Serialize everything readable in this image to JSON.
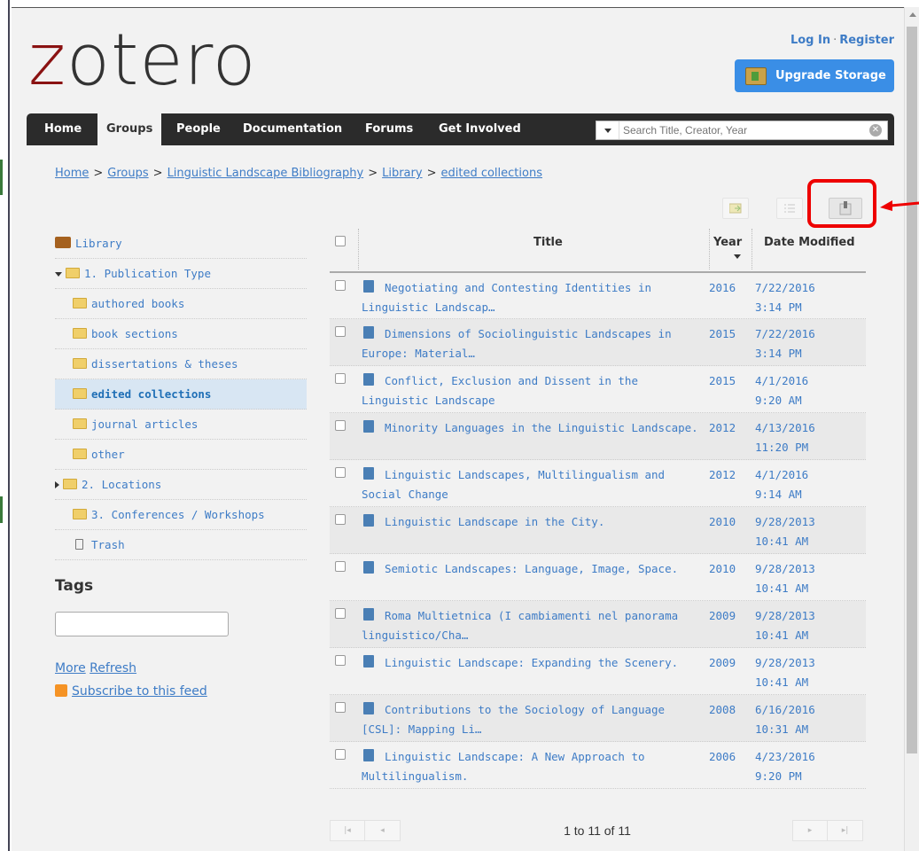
{
  "header": {
    "logo": "zotero",
    "login": "Log In",
    "separator": "·",
    "register": "Register",
    "upgrade": "Upgrade Storage"
  },
  "nav": {
    "items": [
      "Home",
      "Groups",
      "People",
      "Documentation",
      "Forums",
      "Get Involved"
    ],
    "active": "Groups"
  },
  "search": {
    "placeholder": "Search Title, Creator, Year"
  },
  "breadcrumb": [
    "Home",
    "Groups",
    "Linguistic Landscape Bibliography",
    "Library",
    "edited collections"
  ],
  "collections": [
    {
      "label": "Library",
      "icon": "library-icon"
    },
    {
      "label": "1. Publication Type",
      "icon": "folder-icon",
      "expanded": true
    },
    {
      "label": "authored books",
      "icon": "folder-icon"
    },
    {
      "label": "book sections",
      "icon": "folder-icon"
    },
    {
      "label": "dissertations & theses",
      "icon": "folder-icon"
    },
    {
      "label": "edited collections",
      "icon": "folder-icon",
      "selected": true
    },
    {
      "label": "journal articles",
      "icon": "folder-icon"
    },
    {
      "label": "other",
      "icon": "folder-icon"
    },
    {
      "label": "2. Locations",
      "icon": "folder-icon",
      "expanded": false
    },
    {
      "label": "3. Conferences / Workshops",
      "icon": "folder-icon"
    },
    {
      "label": "Trash",
      "icon": "trash-icon"
    }
  ],
  "tags": {
    "heading": "Tags",
    "more": "More",
    "refresh": "Refresh",
    "subscribe": "Subscribe to this feed"
  },
  "table": {
    "headers": {
      "title": "Title",
      "year": "Year",
      "modified": "Date Modified"
    },
    "items": [
      {
        "title": "Negotiating and Contesting Identities in Linguistic Landscap…",
        "year": "2016",
        "date": "7/22/2016",
        "time": "3:14 PM"
      },
      {
        "title": "Dimensions of Sociolinguistic Landscapes in Europe: Material…",
        "year": "2015",
        "date": "7/22/2016",
        "time": "3:14 PM"
      },
      {
        "title": "Conflict, Exclusion and Dissent in the Linguistic Landscape",
        "year": "2015",
        "date": "4/1/2016",
        "time": "9:20 AM"
      },
      {
        "title": "Minority Languages in the Linguistic Landscape.",
        "year": "2012",
        "date": "4/13/2016",
        "time": "11:20 PM"
      },
      {
        "title": "Linguistic Landscapes, Multilingualism and Social Change",
        "year": "2012",
        "date": "4/1/2016",
        "time": "9:14 AM"
      },
      {
        "title": "Linguistic Landscape in the City.",
        "year": "2010",
        "date": "9/28/2013",
        "time": "10:41 AM"
      },
      {
        "title": "Semiotic Landscapes: Language, Image, Space.",
        "year": "2010",
        "date": "9/28/2013",
        "time": "10:41 AM"
      },
      {
        "title": "Roma Multietnica (I cambiamenti nel panorama linguistico/Cha…",
        "year": "2009",
        "date": "9/28/2013",
        "time": "10:41 AM"
      },
      {
        "title": "Linguistic Landscape: Expanding the Scenery.",
        "year": "2009",
        "date": "9/28/2013",
        "time": "10:41 AM"
      },
      {
        "title": "Contributions to the Sociology of Language [CSL]: Mapping Li…",
        "year": "2008",
        "date": "6/16/2016",
        "time": "10:31 AM"
      },
      {
        "title": "Linguistic Landscape: A New Approach to Multilingualism.",
        "year": "2006",
        "date": "4/23/2016",
        "time": "9:20 PM"
      }
    ]
  },
  "pager": {
    "count": "1 to 11 of 11",
    "first": "|◂",
    "prev": "◂",
    "next": "▸",
    "last": "▸|"
  },
  "colors": {
    "link": "#3e7cc6",
    "logo_z": "#8a1212",
    "nav_bg": "#2b2b2b",
    "upgrade_bg": "#3a8ee6",
    "highlight": "#ee0000"
  }
}
